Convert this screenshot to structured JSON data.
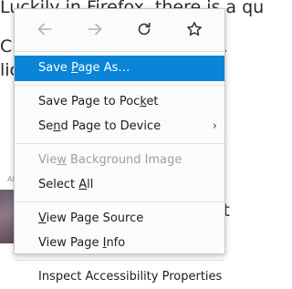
{
  "background": {
    "line1": "Luckily in Firefox, there is a qu",
    "line2": "C",
    "line2_right": "e.",
    "line3": "lic",
    "small_text": "Al",
    "right_char": "t"
  },
  "menu": {
    "nav": {
      "back": "back-arrow-icon",
      "forward": "forward-arrow-icon",
      "reload": "reload-icon",
      "bookmark": "star-icon"
    },
    "items": [
      {
        "label": "Save Page As…",
        "pre": "Save ",
        "key": "P",
        "post": "age As…",
        "state": "selected"
      },
      {
        "label": "Save Page to Pocket",
        "pre": "Save Page to Poc",
        "key": "k",
        "post": "et",
        "state": "normal"
      },
      {
        "label": "Send Page to Device",
        "pre": "Se",
        "key": "n",
        "post": "d Page to Device",
        "state": "normal",
        "submenu": "›"
      },
      {
        "label": "View Background Image",
        "pre": "Vie",
        "key": "w",
        "post": " Background Image",
        "state": "disabled"
      },
      {
        "label": "Select All",
        "pre": "Select ",
        "key": "A",
        "post": "ll",
        "state": "normal"
      },
      {
        "label": "View Page Source",
        "pre": "",
        "key": "V",
        "post": "iew Page Source",
        "state": "normal"
      },
      {
        "label": "View Page Info",
        "pre": "View Page ",
        "key": "I",
        "post": "nfo",
        "state": "normal"
      },
      {
        "label": "Inspect Accessibility Properties",
        "pre": "Inspect Accessibility Properties",
        "key": "",
        "post": "",
        "state": "normal"
      }
    ]
  },
  "colors": {
    "selected_bg": "#0a84d6",
    "menu_bg": "#fbfbfb",
    "disabled_text": "#a0a0a0"
  }
}
